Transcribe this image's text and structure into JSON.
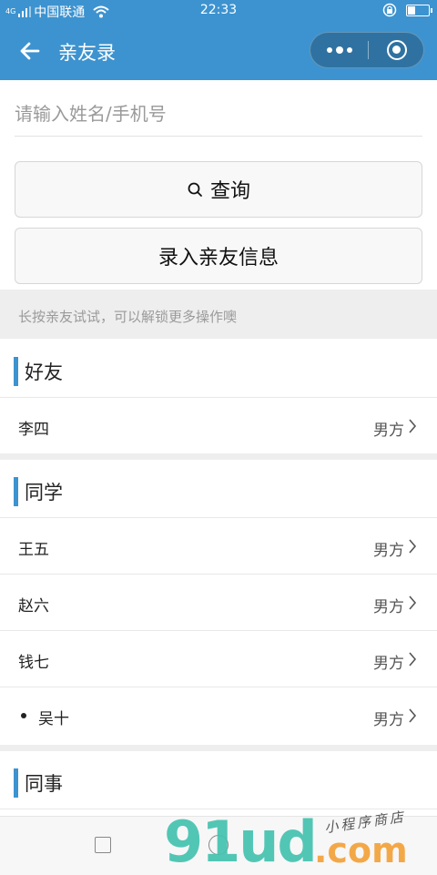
{
  "status_bar": {
    "network_small": "4G",
    "carrier": "中国联通",
    "time": "22:33"
  },
  "nav": {
    "title": "亲友录",
    "back_icon": "arrow-left-icon",
    "more_icon": "more-dots-icon",
    "close_icon": "target-circle-icon"
  },
  "search": {
    "placeholder": "请输入姓名/手机号",
    "value": ""
  },
  "buttons": {
    "query_label": "查询",
    "add_label": "录入亲友信息"
  },
  "tip": "长按亲友试试，可以解锁更多操作噢",
  "groups": [
    {
      "title": "好友",
      "items": [
        {
          "name": "李四",
          "side": "男方"
        }
      ]
    },
    {
      "title": "同学",
      "items": [
        {
          "name": "王五",
          "side": "男方"
        },
        {
          "name": "赵六",
          "side": "男方"
        },
        {
          "name": "钱七",
          "side": "男方"
        },
        {
          "name": "吴十",
          "side": "男方"
        }
      ]
    },
    {
      "title": "同事",
      "items": []
    }
  ],
  "watermark": {
    "main": "91ud",
    "suffix": ".com",
    "sub": "小程序商店"
  },
  "colors": {
    "primary": "#3d93cf",
    "watermark_green": "#45c2b0",
    "watermark_orange": "#f3a23a"
  }
}
